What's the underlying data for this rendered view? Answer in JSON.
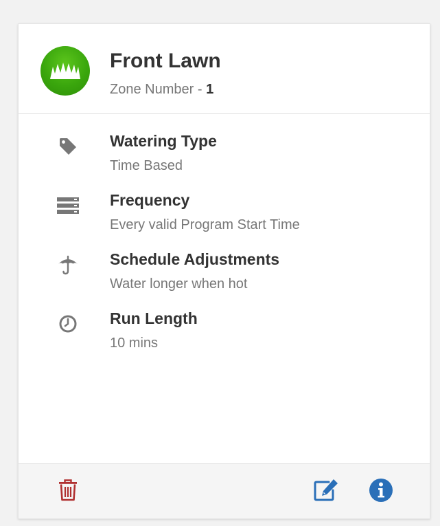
{
  "zone": {
    "name": "Front Lawn",
    "number_label": "Zone Number -",
    "number": "1",
    "avatar_icon": "grass-icon",
    "avatar_color": "#3aa60d"
  },
  "details": [
    {
      "icon": "tag-icon",
      "label": "Watering Type",
      "value": "Time Based"
    },
    {
      "icon": "server-stack-icon",
      "label": "Frequency",
      "value": "Every valid Program Start Time"
    },
    {
      "icon": "umbrella-icon",
      "label": "Schedule Adjustments",
      "value": "Water longer when hot"
    },
    {
      "icon": "clock-icon",
      "label": "Run Length",
      "value": "10 mins"
    }
  ],
  "footer": {
    "delete_icon": "trash-icon",
    "delete_color": "#b03030",
    "edit_icon": "edit-icon",
    "info_icon": "info-circle-icon",
    "action_color": "#2a6fb8"
  },
  "colors": {
    "title": "#333333",
    "muted": "#777777",
    "detail_icon": "#777777"
  }
}
